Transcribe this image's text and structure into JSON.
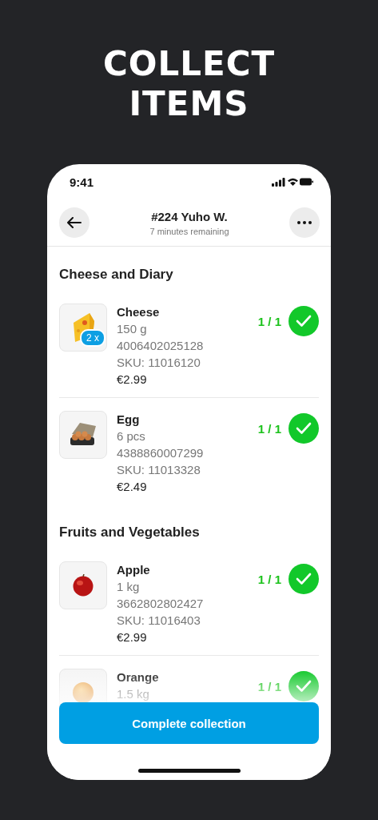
{
  "headline": [
    "COLLECT",
    "ITEMS"
  ],
  "status_bar": {
    "time": "9:41"
  },
  "header": {
    "title": "#224 Yuho W.",
    "subtitle": "7 minutes remaining"
  },
  "sections": [
    {
      "title": "Cheese and Diary",
      "items": [
        {
          "kind": "cheese",
          "name": "Cheese",
          "weight": "150 g",
          "barcode": "4006402025128",
          "sku": "SKU: 11016120",
          "price": "€2.99",
          "quantity_badge": "2 x",
          "count": "1 / 1",
          "collected": true
        },
        {
          "kind": "egg",
          "name": "Egg",
          "weight": "6 pcs",
          "barcode": "4388860007299",
          "sku": "SKU: 11013328",
          "price": "€2.49",
          "count": "1 / 1",
          "collected": true
        }
      ]
    },
    {
      "title": "Fruits and Vegetables",
      "items": [
        {
          "kind": "apple",
          "name": "Apple",
          "weight": "1 kg",
          "barcode": "3662802802427",
          "sku": "SKU: 11016403",
          "price": "€2.99",
          "count": "1 / 1",
          "collected": true
        },
        {
          "kind": "orange",
          "name": "Orange",
          "weight": "1.5 kg",
          "count": "1 / 1",
          "collected": true
        }
      ]
    }
  ],
  "primary_button": "Complete collection"
}
